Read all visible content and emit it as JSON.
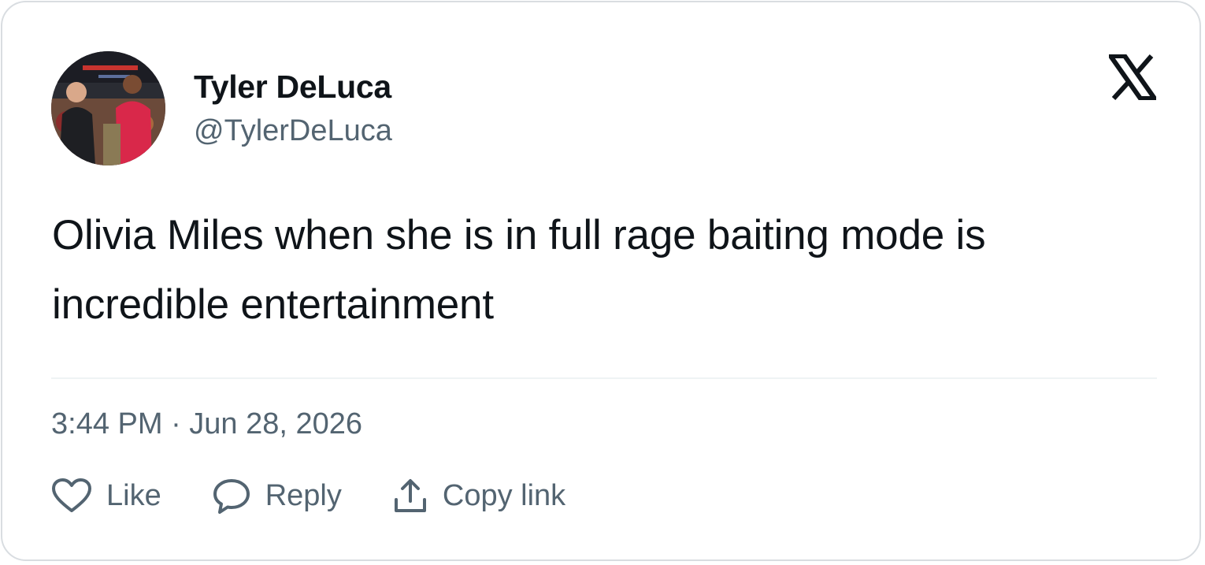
{
  "author": {
    "name": "Tyler DeLuca",
    "handle": "@TylerDeLuca",
    "avatar_icon": "profile-photo"
  },
  "brand": {
    "logo_icon": "x-logo-icon"
  },
  "tweet": {
    "text": "Olivia Miles when she is in full rage baiting mode is incredible entertainment",
    "timestamp": "3:44 PM · Jun 28, 2026"
  },
  "actions": {
    "like_label": "Like",
    "reply_label": "Reply",
    "copy_label": "Copy link"
  },
  "colors": {
    "text_primary": "#0f1419",
    "text_secondary": "#536471",
    "border": "#d9dde1",
    "divider": "#eff3f4"
  }
}
